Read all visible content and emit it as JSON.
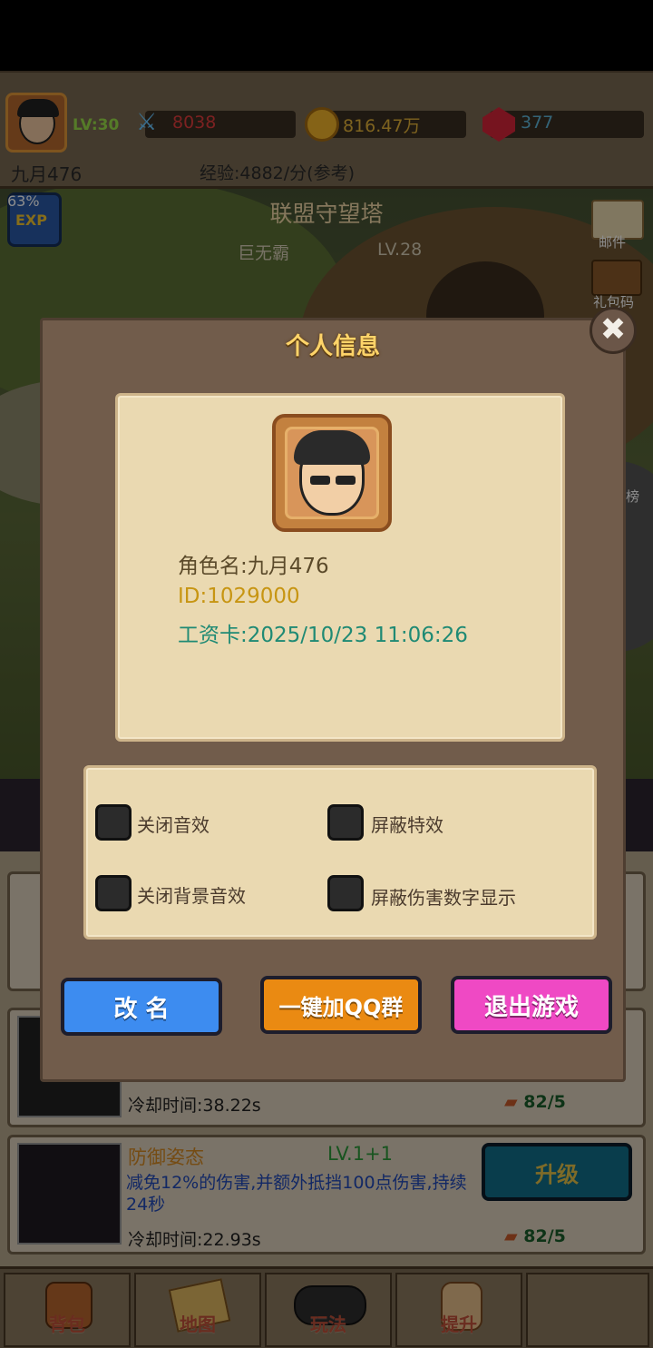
{
  "topbar": {
    "level": "LV:30",
    "attack": "8038",
    "gold": "816.47万",
    "gems": "377",
    "player_name": "九月476",
    "exp_rate": "经验:4882/分(参考)",
    "exp_percent": "63%"
  },
  "scene": {
    "location_title": "联盟守望塔",
    "boss_name": "巨无霸",
    "boss_level": "LV.28",
    "side_mail": "邮件",
    "side_gift": "礼包码",
    "side_rank_partial": "榜"
  },
  "modal": {
    "title": "个人信息",
    "role_name": "角色名:九月476",
    "id": "ID:1029000",
    "salary_card": "工资卡:2025/10/23 11:06:26",
    "settings": {
      "mute_sfx": "关闭音效",
      "hide_effects": "屏蔽特效",
      "mute_bgm": "关闭背景音效",
      "hide_damage": "屏蔽伤害数字显示"
    },
    "buttons": {
      "rename": "改 名",
      "join_qq": "一键加QQ群",
      "quit": "退出游戏"
    }
  },
  "skills": [
    {
      "cooldown": "冷却时间:38.22s",
      "cost": "82/5"
    },
    {
      "name": "防御姿态",
      "level": "LV.1+1",
      "description": "减免12%的伤害,并额外抵挡100点伤害,持续24秒",
      "cooldown": "冷却时间:22.93s",
      "cost": "82/5",
      "upgrade_label": "升级"
    }
  ],
  "nav": {
    "bag": "背包",
    "map": "地图",
    "play": "玩法",
    "upgrade": "提升"
  },
  "colors": {
    "panel": "#715c4b",
    "parchment": "#ead9b1",
    "title_gold": "#ffd469",
    "rename_blue": "#3d8cf0",
    "qq_orange": "#ea8a12",
    "quit_pink": "#ef49c4"
  }
}
